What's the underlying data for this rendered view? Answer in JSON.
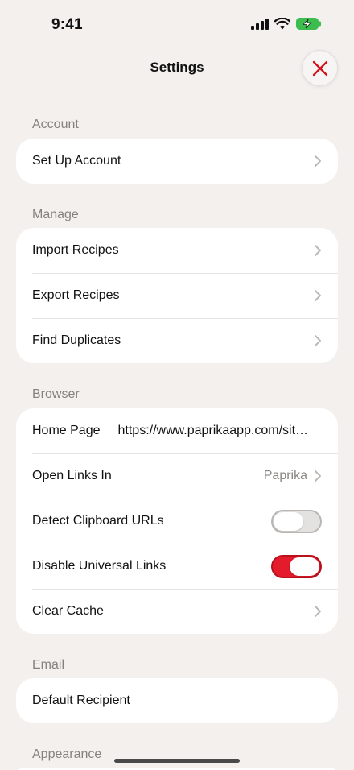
{
  "status_bar": {
    "time": "9:41",
    "battery_color": "#3dbd4e"
  },
  "header": {
    "title": "Settings",
    "close_icon": "close-x-icon",
    "accent_color": "#d0121d"
  },
  "sections": {
    "account": {
      "header": "Account",
      "rows": [
        {
          "label": "Set Up Account",
          "icon": "chevron-right-icon"
        }
      ]
    },
    "manage": {
      "header": "Manage",
      "rows": [
        {
          "label": "Import Recipes",
          "icon": "chevron-right-icon"
        },
        {
          "label": "Export Recipes",
          "icon": "chevron-right-icon"
        },
        {
          "label": "Find Duplicates",
          "icon": "chevron-right-icon"
        }
      ]
    },
    "browser": {
      "header": "Browser",
      "home_page": {
        "label": "Home Page",
        "value": "https://www.paprikaapp.com/sit…"
      },
      "open_links_in": {
        "label": "Open Links In",
        "value": "Paprika"
      },
      "detect_clipboard": {
        "label": "Detect Clipboard URLs",
        "toggle": false
      },
      "disable_universal": {
        "label": "Disable Universal Links",
        "toggle": true
      },
      "clear_cache": {
        "label": "Clear Cache"
      }
    },
    "email": {
      "header": "Email",
      "rows": [
        {
          "label": "Default Recipient"
        }
      ]
    },
    "appearance": {
      "header": "Appearance"
    }
  }
}
